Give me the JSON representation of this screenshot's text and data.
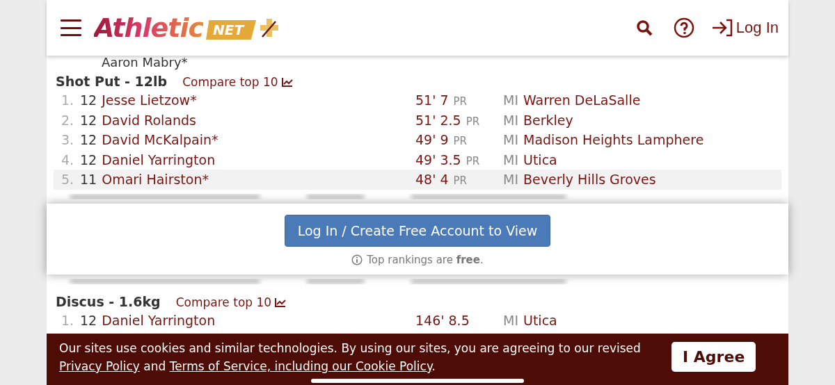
{
  "header": {
    "logo": {
      "wordmark": "Athletic",
      "badge": "NET"
    },
    "login_label": "Log In"
  },
  "previous_tail": "Aaron Mabry*",
  "events_top": [
    {
      "title": "Shot Put - 12lb",
      "compare_label": "Compare top 10",
      "rows": [
        {
          "rank": "1.",
          "grade": "12",
          "name": "Jesse Lietzow*",
          "mark": "51' 7",
          "pr": "PR",
          "state": "MI",
          "school": "Warren DeLaSalle",
          "highlighted": false
        },
        {
          "rank": "2.",
          "grade": "12",
          "name": "David Rolands",
          "mark": "51' 2.5",
          "pr": "PR",
          "state": "MI",
          "school": "Berkley",
          "highlighted": false
        },
        {
          "rank": "3.",
          "grade": "12",
          "name": "David McKalpain*",
          "mark": "49' 9",
          "pr": "PR",
          "state": "MI",
          "school": "Madison Heights Lamphere",
          "highlighted": false
        },
        {
          "rank": "4.",
          "grade": "12",
          "name": "Daniel Yarrington",
          "mark": "49' 3.5",
          "pr": "PR",
          "state": "MI",
          "school": "Utica",
          "highlighted": false
        },
        {
          "rank": "5.",
          "grade": "11",
          "name": "Omari Hairston*",
          "mark": "48' 4",
          "pr": "PR",
          "state": "MI",
          "school": "Beverly Hills Groves",
          "highlighted": true
        }
      ]
    }
  ],
  "gate": {
    "button": "Log In / Create Free Account to View",
    "note": "Top rankings are **free**."
  },
  "events_bottom": [
    {
      "title": "Discus - 1.6kg",
      "compare_label": "Compare top 10",
      "rows": [
        {
          "rank": "1.",
          "grade": "12",
          "name": "Daniel Yarrington",
          "mark": "146' 8.5",
          "state": "MI",
          "school": "Utica",
          "highlighted": false
        }
      ]
    }
  ],
  "cookie_bar": {
    "text_before": "Our sites use cookies and similar technologies. By using our sites, you are agreeing to our revised ",
    "privacy_link": "Privacy Policy",
    "text_middle": " and ",
    "terms_link": "Terms of Service, including our Cookie Policy",
    "text_after": ".",
    "agree_button": "I Agree"
  }
}
